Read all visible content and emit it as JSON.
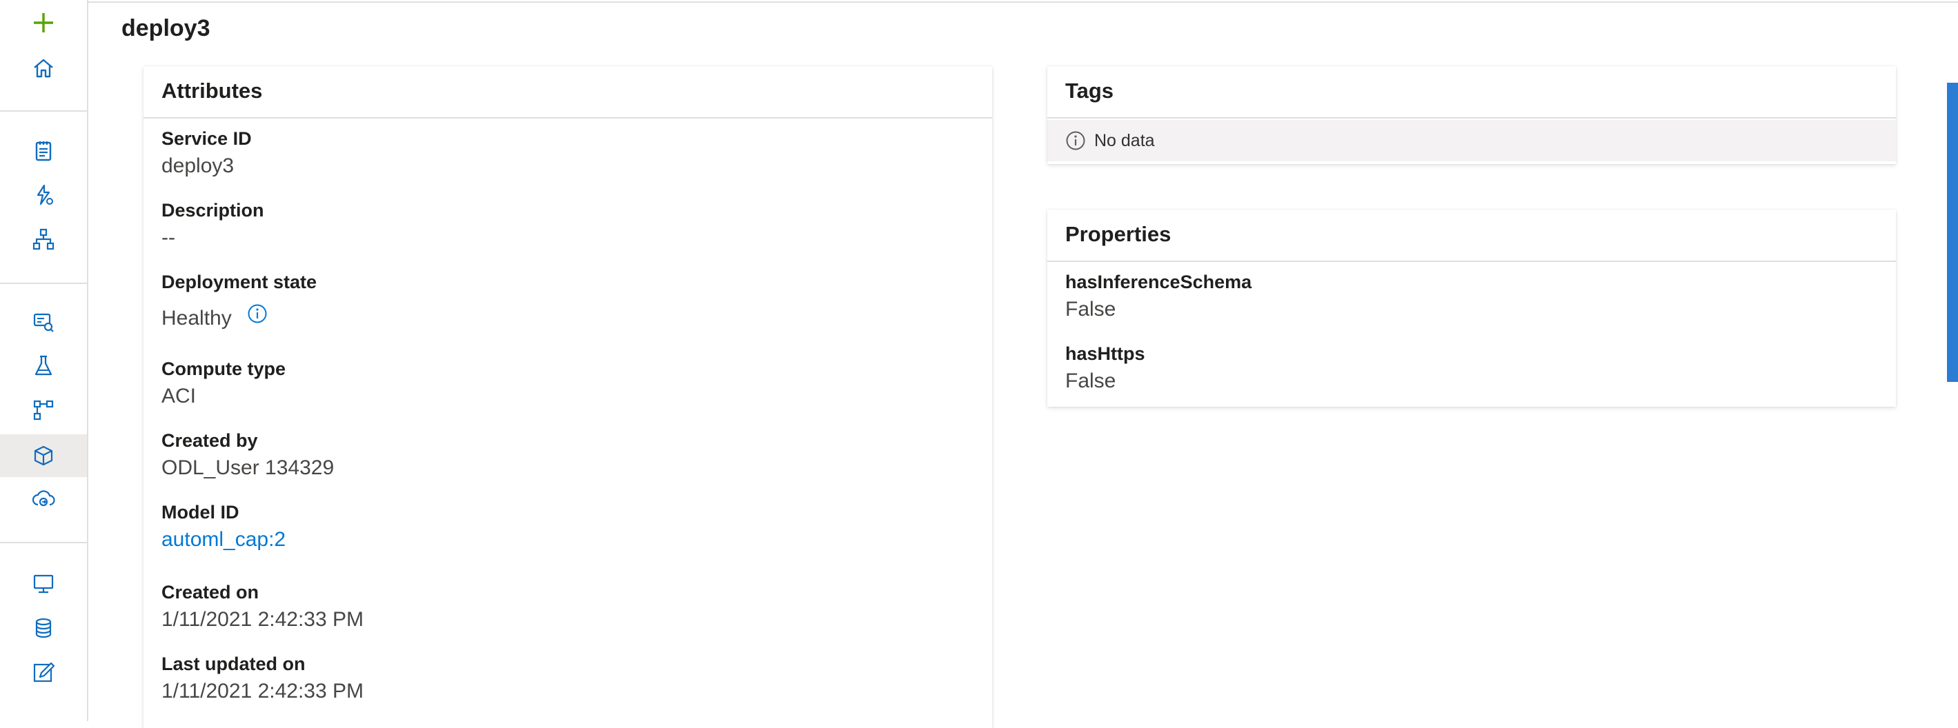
{
  "page": {
    "title": "deploy3"
  },
  "nav": {
    "items": [
      {
        "icon": "plus-icon"
      },
      {
        "icon": "home-icon"
      },
      {
        "icon": "notebook-icon"
      },
      {
        "icon": "automated-ml-icon"
      },
      {
        "icon": "designer-icon"
      },
      {
        "icon": "datasets-icon"
      },
      {
        "icon": "experiments-icon"
      },
      {
        "icon": "pipelines-icon"
      },
      {
        "icon": "models-icon"
      },
      {
        "icon": "endpoints-icon"
      },
      {
        "icon": "compute-icon"
      },
      {
        "icon": "datastores-icon"
      },
      {
        "icon": "data-labeling-icon"
      }
    ],
    "selected": "models-icon"
  },
  "attributes": {
    "title": "Attributes",
    "fields": {
      "service_id": {
        "label": "Service ID",
        "value": "deploy3"
      },
      "description": {
        "label": "Description",
        "value": "--"
      },
      "deployment_state": {
        "label": "Deployment state",
        "value": "Healthy"
      },
      "compute_type": {
        "label": "Compute type",
        "value": "ACI"
      },
      "created_by": {
        "label": "Created by",
        "value": "ODL_User 134329"
      },
      "model_id": {
        "label": "Model ID",
        "value": "automl_cap:2"
      },
      "created_on": {
        "label": "Created on",
        "value": "1/11/2021 2:42:33 PM"
      },
      "last_updated_on": {
        "label": "Last updated on",
        "value": "1/11/2021 2:42:33 PM"
      }
    }
  },
  "tags": {
    "title": "Tags",
    "empty_text": "No data"
  },
  "properties": {
    "title": "Properties",
    "fields": {
      "has_inference_schema": {
        "label": "hasInferenceSchema",
        "value": "False"
      },
      "has_https": {
        "label": "hasHttps",
        "value": "False"
      }
    }
  },
  "colors": {
    "accent": "#0078d4",
    "plus": "#57a300",
    "icon": "#0f6cbd",
    "side_panel": "#2b7cd3"
  }
}
